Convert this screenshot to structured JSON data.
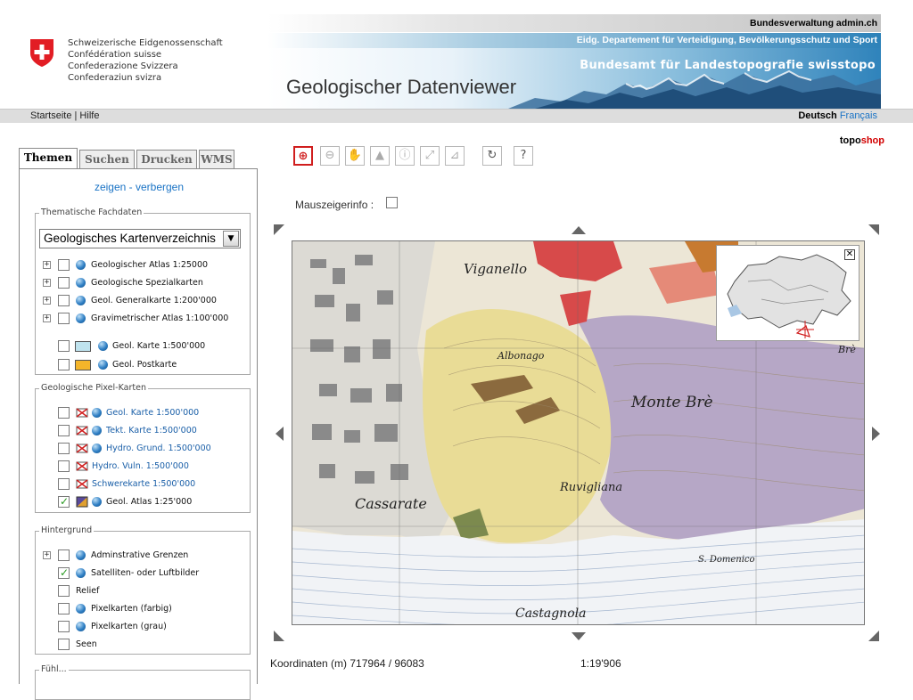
{
  "header": {
    "confederation": [
      "Schweizerische Eidgenossenschaft",
      "Confédération suisse",
      "Confederazione Svizzera",
      "Confederaziun svizra"
    ],
    "admin": "Bundesverwaltung admin.ch",
    "department": "Eidg. Departement für Verteidigung, Bevölkerungsschutz und Sport",
    "office": "Bundesamt für Landestopografie swisstopo",
    "app_title": "Geologischer Datenviewer"
  },
  "nav": {
    "left": "Startseite | Hilfe",
    "lang_de": "Deutsch",
    "lang_fr": "Français",
    "shop_part1": "topo",
    "shop_part2": "shop"
  },
  "tabs": [
    "Themen",
    "Suchen",
    "Drucken",
    "WMS"
  ],
  "panel": {
    "show_hide": "zeigen - verbergen",
    "thematic": {
      "legend": "Thematische Fachdaten",
      "select_value": "Geologisches Kartenverzeichnis",
      "items": [
        {
          "label": "Geologischer Atlas 1:25000"
        },
        {
          "label": "Geologische Spezialkarten"
        },
        {
          "label": "Geol. Generalkarte 1:200'000"
        },
        {
          "label": "Gravimetrischer Atlas 1:100'000"
        },
        {
          "label": "Geol. Karte 1:500'000",
          "swatch": "#bfe3ee"
        },
        {
          "label": "Geol. Postkarte",
          "swatch": "#f4b52a"
        }
      ]
    },
    "pixel": {
      "legend": "Geologische Pixel-Karten",
      "items": [
        {
          "label": "Geol. Karte 1:500'000"
        },
        {
          "label": "Tekt. Karte 1:500'000"
        },
        {
          "label": "Hydro. Grund. 1:500'000"
        },
        {
          "label": "Hydro. Vuln. 1:500'000"
        },
        {
          "label": "Schwerekarte 1:500'000"
        },
        {
          "label": "Geol. Atlas 1:25'000"
        }
      ]
    },
    "background": {
      "legend": "Hintergrund",
      "items": [
        {
          "label": "Adminstrative Grenzen"
        },
        {
          "label": "Satelliten- oder Luftbilder"
        },
        {
          "label": "Relief"
        },
        {
          "label": "Pixelkarten (farbig)"
        },
        {
          "label": "Pixelkarten (grau)"
        },
        {
          "label": "Seen"
        }
      ]
    },
    "next_legend": "Fühl..."
  },
  "toolbar": {
    "tools": [
      "zoom-in-icon",
      "zoom-out-icon",
      "pan-hand-icon",
      "zoom-extent-icon",
      "identify-icon",
      "measure-distance-icon",
      "measure-area-icon",
      "refresh-icon",
      "help-icon"
    ],
    "mouse_info_label": "Mauszeigerinfo :"
  },
  "map": {
    "labels": [
      "Viganello",
      "Albonago",
      "Monte Brè",
      "Cassarate",
      "Castagnola",
      "Ruvigliana",
      "S. Domenico",
      "Brè"
    ]
  },
  "status": {
    "coords": "Koordinaten (m) 717964 / 96083",
    "scale": "1:19'906"
  }
}
